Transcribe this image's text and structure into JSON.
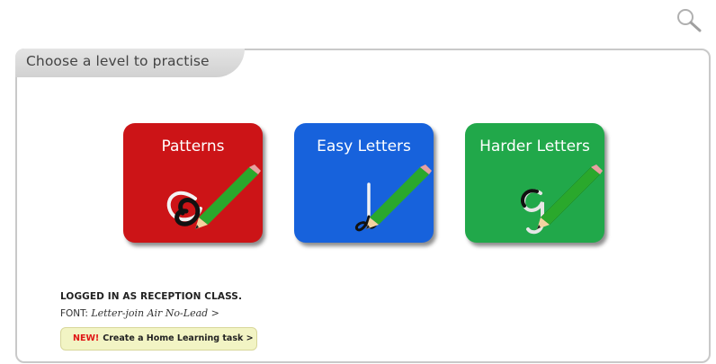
{
  "search": {
    "icon": "search-icon"
  },
  "panel": {
    "title": "Choose a level to practise"
  },
  "levels": [
    {
      "label": "Patterns",
      "color": "#cc1417",
      "icon": "pattern-spiral-pencil-icon"
    },
    {
      "label": "Easy Letters",
      "color": "#1762dc",
      "icon": "letter-l-pencil-icon"
    },
    {
      "label": "Harder Letters",
      "color": "#21a84a",
      "icon": "letter-g-pencil-icon"
    }
  ],
  "account": {
    "status": "LOGGED IN AS RECEPTION CLASS.",
    "font_prefix": "FONT:",
    "font_value": "Letter-join Air No-Lead >"
  },
  "task_button": {
    "badge": "NEW!",
    "label": "Create a Home Learning task >"
  }
}
